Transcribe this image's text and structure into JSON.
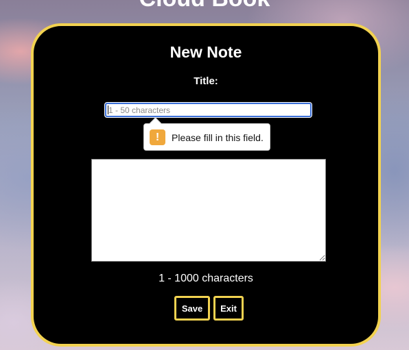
{
  "app": {
    "title": "Cloud Book"
  },
  "form": {
    "heading": "New Note",
    "title_label": "Title:",
    "title_input": {
      "value": "",
      "placeholder": "1 - 50 characters"
    },
    "validation_tooltip": {
      "icon": "exclamation-warning-icon",
      "message": "Please fill in this field."
    },
    "body_textarea": {
      "value": ""
    },
    "body_hint": "1 - 1000 characters",
    "buttons": {
      "save_label": "Save",
      "exit_label": "Exit"
    }
  },
  "colors": {
    "accent_border": "#f2d250",
    "card_background": "#000000",
    "warning_icon": "#f0a83c",
    "focus_ring": "#3a6fd8"
  }
}
